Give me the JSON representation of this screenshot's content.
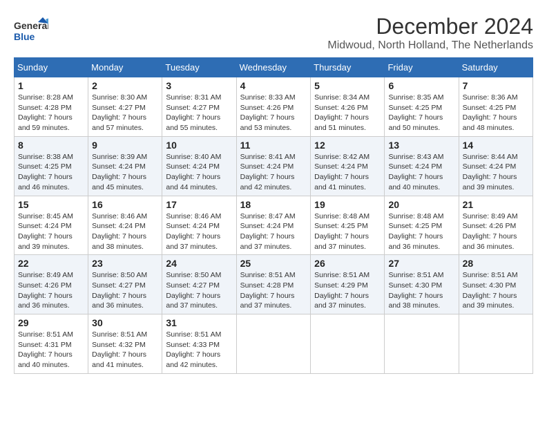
{
  "header": {
    "logo_general": "General",
    "logo_blue": "Blue",
    "month": "December 2024",
    "location": "Midwoud, North Holland, The Netherlands"
  },
  "weekdays": [
    "Sunday",
    "Monday",
    "Tuesday",
    "Wednesday",
    "Thursday",
    "Friday",
    "Saturday"
  ],
  "weeks": [
    [
      {
        "day": 1,
        "sunrise": "Sunrise: 8:28 AM",
        "sunset": "Sunset: 4:28 PM",
        "daylight": "Daylight: 7 hours and 59 minutes."
      },
      {
        "day": 2,
        "sunrise": "Sunrise: 8:30 AM",
        "sunset": "Sunset: 4:27 PM",
        "daylight": "Daylight: 7 hours and 57 minutes."
      },
      {
        "day": 3,
        "sunrise": "Sunrise: 8:31 AM",
        "sunset": "Sunset: 4:27 PM",
        "daylight": "Daylight: 7 hours and 55 minutes."
      },
      {
        "day": 4,
        "sunrise": "Sunrise: 8:33 AM",
        "sunset": "Sunset: 4:26 PM",
        "daylight": "Daylight: 7 hours and 53 minutes."
      },
      {
        "day": 5,
        "sunrise": "Sunrise: 8:34 AM",
        "sunset": "Sunset: 4:26 PM",
        "daylight": "Daylight: 7 hours and 51 minutes."
      },
      {
        "day": 6,
        "sunrise": "Sunrise: 8:35 AM",
        "sunset": "Sunset: 4:25 PM",
        "daylight": "Daylight: 7 hours and 50 minutes."
      },
      {
        "day": 7,
        "sunrise": "Sunrise: 8:36 AM",
        "sunset": "Sunset: 4:25 PM",
        "daylight": "Daylight: 7 hours and 48 minutes."
      }
    ],
    [
      {
        "day": 8,
        "sunrise": "Sunrise: 8:38 AM",
        "sunset": "Sunset: 4:25 PM",
        "daylight": "Daylight: 7 hours and 46 minutes."
      },
      {
        "day": 9,
        "sunrise": "Sunrise: 8:39 AM",
        "sunset": "Sunset: 4:24 PM",
        "daylight": "Daylight: 7 hours and 45 minutes."
      },
      {
        "day": 10,
        "sunrise": "Sunrise: 8:40 AM",
        "sunset": "Sunset: 4:24 PM",
        "daylight": "Daylight: 7 hours and 44 minutes."
      },
      {
        "day": 11,
        "sunrise": "Sunrise: 8:41 AM",
        "sunset": "Sunset: 4:24 PM",
        "daylight": "Daylight: 7 hours and 42 minutes."
      },
      {
        "day": 12,
        "sunrise": "Sunrise: 8:42 AM",
        "sunset": "Sunset: 4:24 PM",
        "daylight": "Daylight: 7 hours and 41 minutes."
      },
      {
        "day": 13,
        "sunrise": "Sunrise: 8:43 AM",
        "sunset": "Sunset: 4:24 PM",
        "daylight": "Daylight: 7 hours and 40 minutes."
      },
      {
        "day": 14,
        "sunrise": "Sunrise: 8:44 AM",
        "sunset": "Sunset: 4:24 PM",
        "daylight": "Daylight: 7 hours and 39 minutes."
      }
    ],
    [
      {
        "day": 15,
        "sunrise": "Sunrise: 8:45 AM",
        "sunset": "Sunset: 4:24 PM",
        "daylight": "Daylight: 7 hours and 39 minutes."
      },
      {
        "day": 16,
        "sunrise": "Sunrise: 8:46 AM",
        "sunset": "Sunset: 4:24 PM",
        "daylight": "Daylight: 7 hours and 38 minutes."
      },
      {
        "day": 17,
        "sunrise": "Sunrise: 8:46 AM",
        "sunset": "Sunset: 4:24 PM",
        "daylight": "Daylight: 7 hours and 37 minutes."
      },
      {
        "day": 18,
        "sunrise": "Sunrise: 8:47 AM",
        "sunset": "Sunset: 4:24 PM",
        "daylight": "Daylight: 7 hours and 37 minutes."
      },
      {
        "day": 19,
        "sunrise": "Sunrise: 8:48 AM",
        "sunset": "Sunset: 4:25 PM",
        "daylight": "Daylight: 7 hours and 37 minutes."
      },
      {
        "day": 20,
        "sunrise": "Sunrise: 8:48 AM",
        "sunset": "Sunset: 4:25 PM",
        "daylight": "Daylight: 7 hours and 36 minutes."
      },
      {
        "day": 21,
        "sunrise": "Sunrise: 8:49 AM",
        "sunset": "Sunset: 4:26 PM",
        "daylight": "Daylight: 7 hours and 36 minutes."
      }
    ],
    [
      {
        "day": 22,
        "sunrise": "Sunrise: 8:49 AM",
        "sunset": "Sunset: 4:26 PM",
        "daylight": "Daylight: 7 hours and 36 minutes."
      },
      {
        "day": 23,
        "sunrise": "Sunrise: 8:50 AM",
        "sunset": "Sunset: 4:27 PM",
        "daylight": "Daylight: 7 hours and 36 minutes."
      },
      {
        "day": 24,
        "sunrise": "Sunrise: 8:50 AM",
        "sunset": "Sunset: 4:27 PM",
        "daylight": "Daylight: 7 hours and 37 minutes."
      },
      {
        "day": 25,
        "sunrise": "Sunrise: 8:51 AM",
        "sunset": "Sunset: 4:28 PM",
        "daylight": "Daylight: 7 hours and 37 minutes."
      },
      {
        "day": 26,
        "sunrise": "Sunrise: 8:51 AM",
        "sunset": "Sunset: 4:29 PM",
        "daylight": "Daylight: 7 hours and 37 minutes."
      },
      {
        "day": 27,
        "sunrise": "Sunrise: 8:51 AM",
        "sunset": "Sunset: 4:30 PM",
        "daylight": "Daylight: 7 hours and 38 minutes."
      },
      {
        "day": 28,
        "sunrise": "Sunrise: 8:51 AM",
        "sunset": "Sunset: 4:30 PM",
        "daylight": "Daylight: 7 hours and 39 minutes."
      }
    ],
    [
      {
        "day": 29,
        "sunrise": "Sunrise: 8:51 AM",
        "sunset": "Sunset: 4:31 PM",
        "daylight": "Daylight: 7 hours and 40 minutes."
      },
      {
        "day": 30,
        "sunrise": "Sunrise: 8:51 AM",
        "sunset": "Sunset: 4:32 PM",
        "daylight": "Daylight: 7 hours and 41 minutes."
      },
      {
        "day": 31,
        "sunrise": "Sunrise: 8:51 AM",
        "sunset": "Sunset: 4:33 PM",
        "daylight": "Daylight: 7 hours and 42 minutes."
      },
      null,
      null,
      null,
      null
    ]
  ]
}
